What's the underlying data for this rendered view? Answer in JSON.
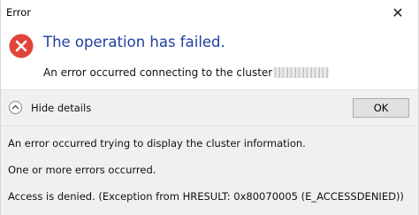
{
  "window": {
    "title": "Error"
  },
  "header": {
    "heading": "The operation has failed.",
    "message": "An error occurred connecting to the cluster"
  },
  "details_toggle": {
    "label": "Hide details"
  },
  "ok_button": {
    "label": "OK"
  },
  "details": {
    "line1": "An error occurred trying to display the cluster information.",
    "line2": "One or more errors occurred.",
    "line3": "Access is denied. (Exception from HRESULT: 0x80070005 (E_ACCESSDENIED))"
  },
  "icons": {
    "error": "error-icon",
    "close": "close-icon",
    "toggle": "chevron-up-icon"
  },
  "colors": {
    "heading": "#1f3f9f",
    "error_icon": "#e0443a",
    "panel_bg": "#f0f0f0"
  }
}
